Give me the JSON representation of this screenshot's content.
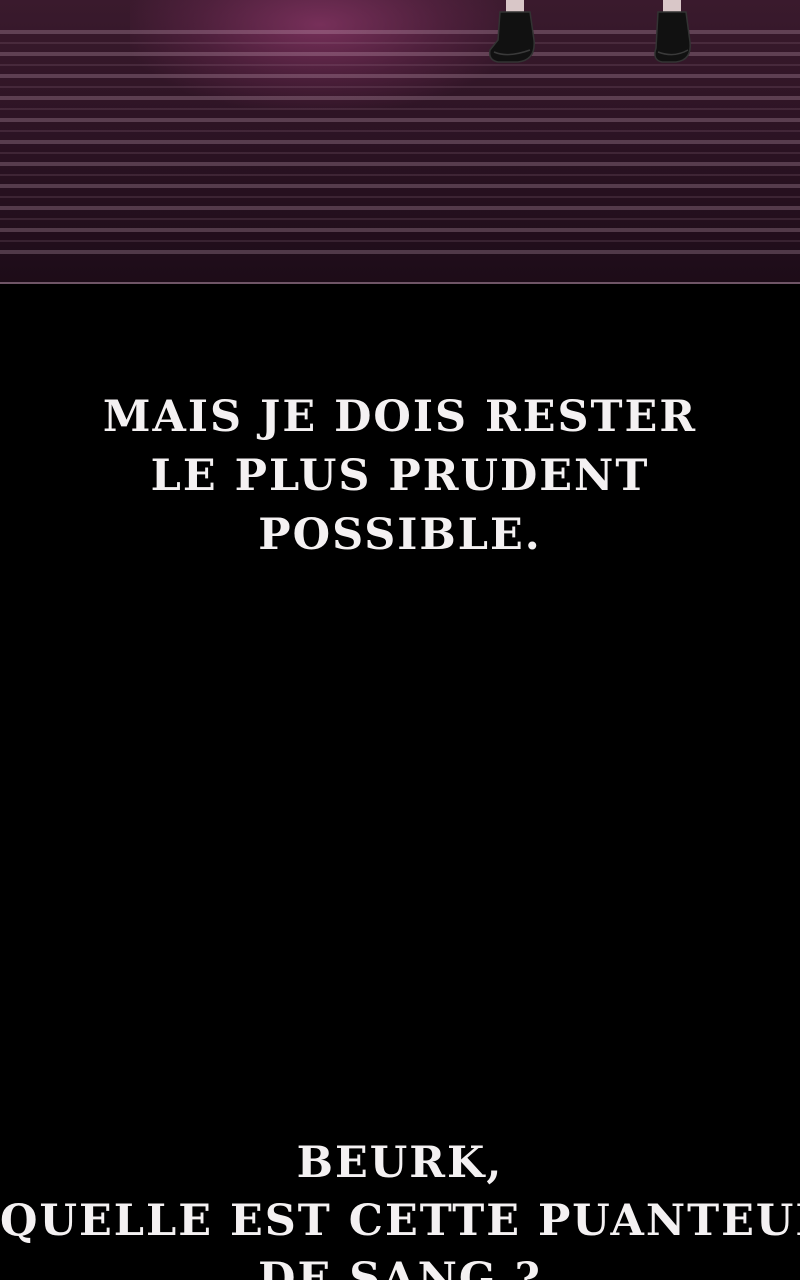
{
  "panel_top": {
    "colors": {
      "background": "#2a1222",
      "spotlight": "#8c3769",
      "stripe": "#cdaabe"
    }
  },
  "captions": [
    {
      "lines": [
        "MAIS JE DOIS RESTER",
        "LE PLUS PRUDENT",
        "POSSIBLE."
      ]
    },
    {
      "lines": [
        "BEURK,",
        "QUELLE EST CETTE PUANTEUR",
        "DE SANG ?"
      ]
    }
  ],
  "colors": {
    "page_background": "#000000",
    "caption_text": "#f4f1f2"
  }
}
